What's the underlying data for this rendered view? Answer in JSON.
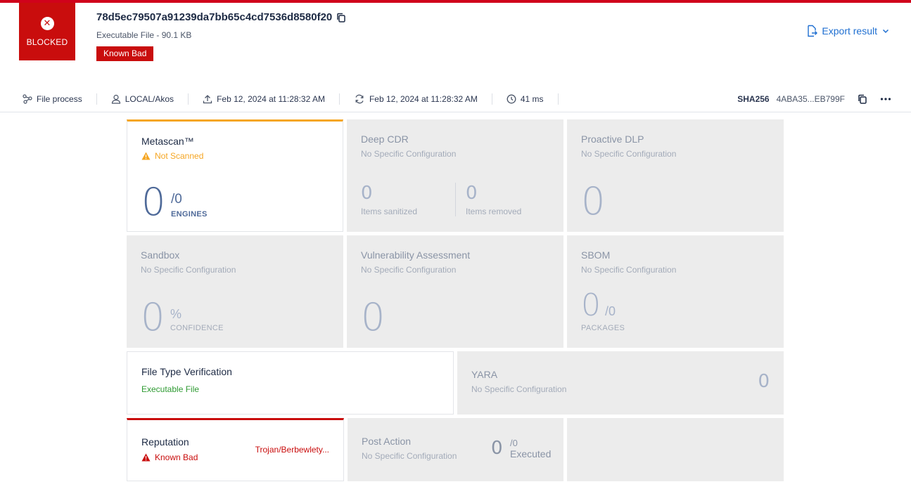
{
  "header": {
    "verdict_label": "BLOCKED",
    "file_name": "78d5ec79507a91239da7bb65c4cd7536d8580f20",
    "file_info": "Executable File - 90.1 KB",
    "verdict_badge": "Known Bad",
    "export_label": "Export result"
  },
  "meta": {
    "process_label": "File process",
    "user": "LOCAL/Akos",
    "uploaded": "Feb 12, 2024 at 11:28:32 AM",
    "processed": "Feb 12, 2024 at 11:28:32 AM",
    "duration": "41 ms",
    "hash_label": "SHA256",
    "hash_value": "4ABA35...EB799F"
  },
  "cards": {
    "metascan": {
      "title": "Metascan™",
      "status": "Not Scanned",
      "value": "0",
      "total": "/0",
      "unit": "ENGINES"
    },
    "deep_cdr": {
      "title": "Deep CDR",
      "sub": "No Specific Configuration",
      "sanitized_value": "0",
      "sanitized_label": "Items sanitized",
      "removed_value": "0",
      "removed_label": "Items removed"
    },
    "proactive_dlp": {
      "title": "Proactive DLP",
      "sub": "No Specific Configuration",
      "value": "0"
    },
    "sandbox": {
      "title": "Sandbox",
      "sub": "No Specific Configuration",
      "value": "0",
      "unit_symbol": "%",
      "unit": "CONFIDENCE"
    },
    "vulnerability": {
      "title": "Vulnerability Assessment",
      "sub": "No Specific Configuration",
      "value": "0"
    },
    "sbom": {
      "title": "SBOM",
      "sub": "No Specific Configuration",
      "value": "0",
      "total": "/0",
      "unit": "PACKAGES"
    },
    "file_type": {
      "title": "File Type Verification",
      "status": "Executable File"
    },
    "yara": {
      "title": "YARA",
      "sub": "No Specific Configuration",
      "value": "0"
    },
    "reputation": {
      "title": "Reputation",
      "status": "Known Bad",
      "threat": "Trojan/Berbewlety..."
    },
    "post_action": {
      "title": "Post Action",
      "sub": "No Specific Configuration",
      "value": "0",
      "total": "/0",
      "unit": "Executed"
    }
  },
  "colors": {
    "danger": "#c90d0d",
    "warning": "#f5a623",
    "success": "#2e9a32",
    "accent": "#1f6fd1"
  }
}
